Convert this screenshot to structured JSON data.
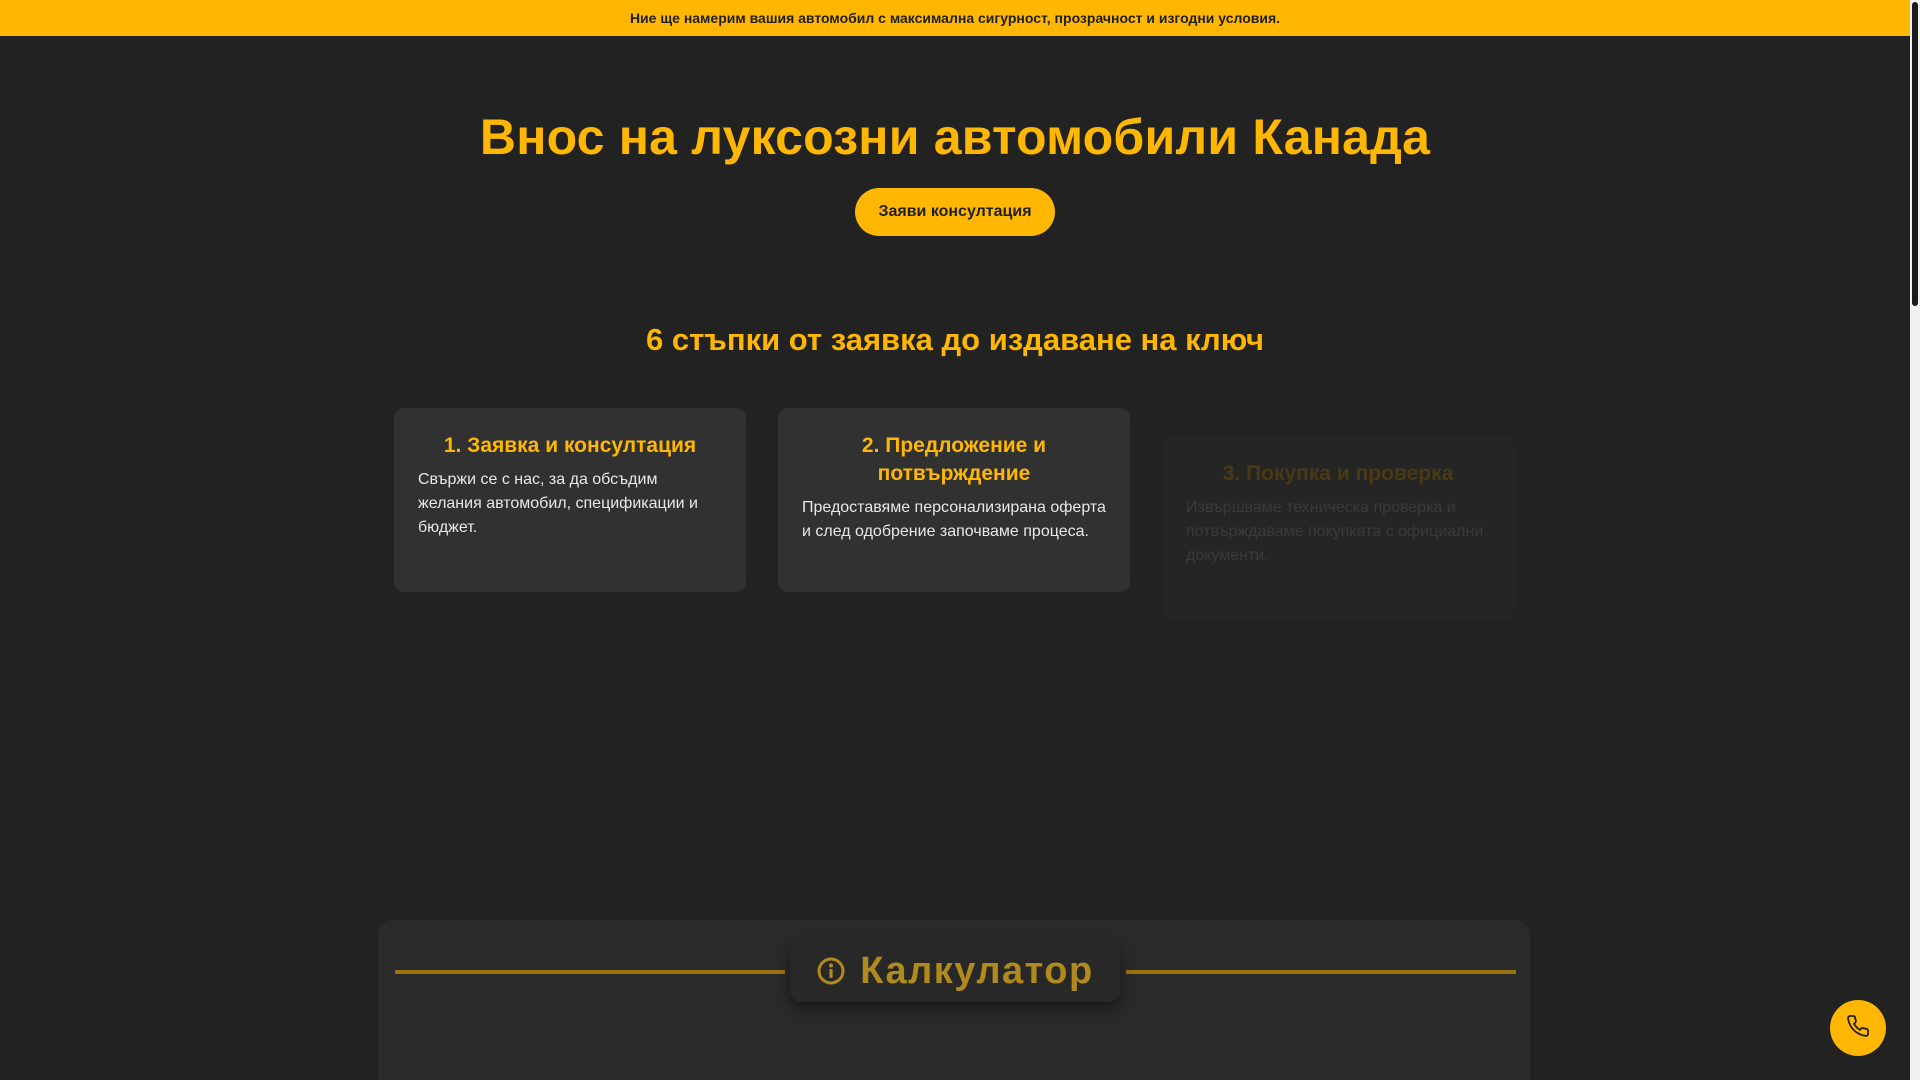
{
  "banner": {
    "text": "Ние ще намерим вашия автомобил с максимална сигурност, прозрачност и изгодни условия."
  },
  "hero": {
    "title": "Внос на луксозни автомобили Канада",
    "cta_label": "Заяви консултация"
  },
  "steps": {
    "heading": "6 стъпки от заявка до издаване на ключ",
    "items": [
      {
        "title": "1. Заявка и консултация",
        "text": "Свържи се с нас, за да обсъдим желания автомобил, спецификации и бюджет."
      },
      {
        "title": "2. Предложение и потвърждение",
        "text": "Предоставяме персонализирана оферта и след одобрение започваме процеса."
      },
      {
        "title": "3. Покупка и проверка",
        "text": "Извършваме техническа проверка и потвърждаваме покупката с официални документи."
      }
    ]
  },
  "calculator": {
    "title": "Калкулатор",
    "icon": "info-icon"
  },
  "floating": {
    "phone_icon": "phone-icon"
  },
  "colors": {
    "accent": "#ffb703",
    "background": "#222222",
    "card": "#313131"
  }
}
